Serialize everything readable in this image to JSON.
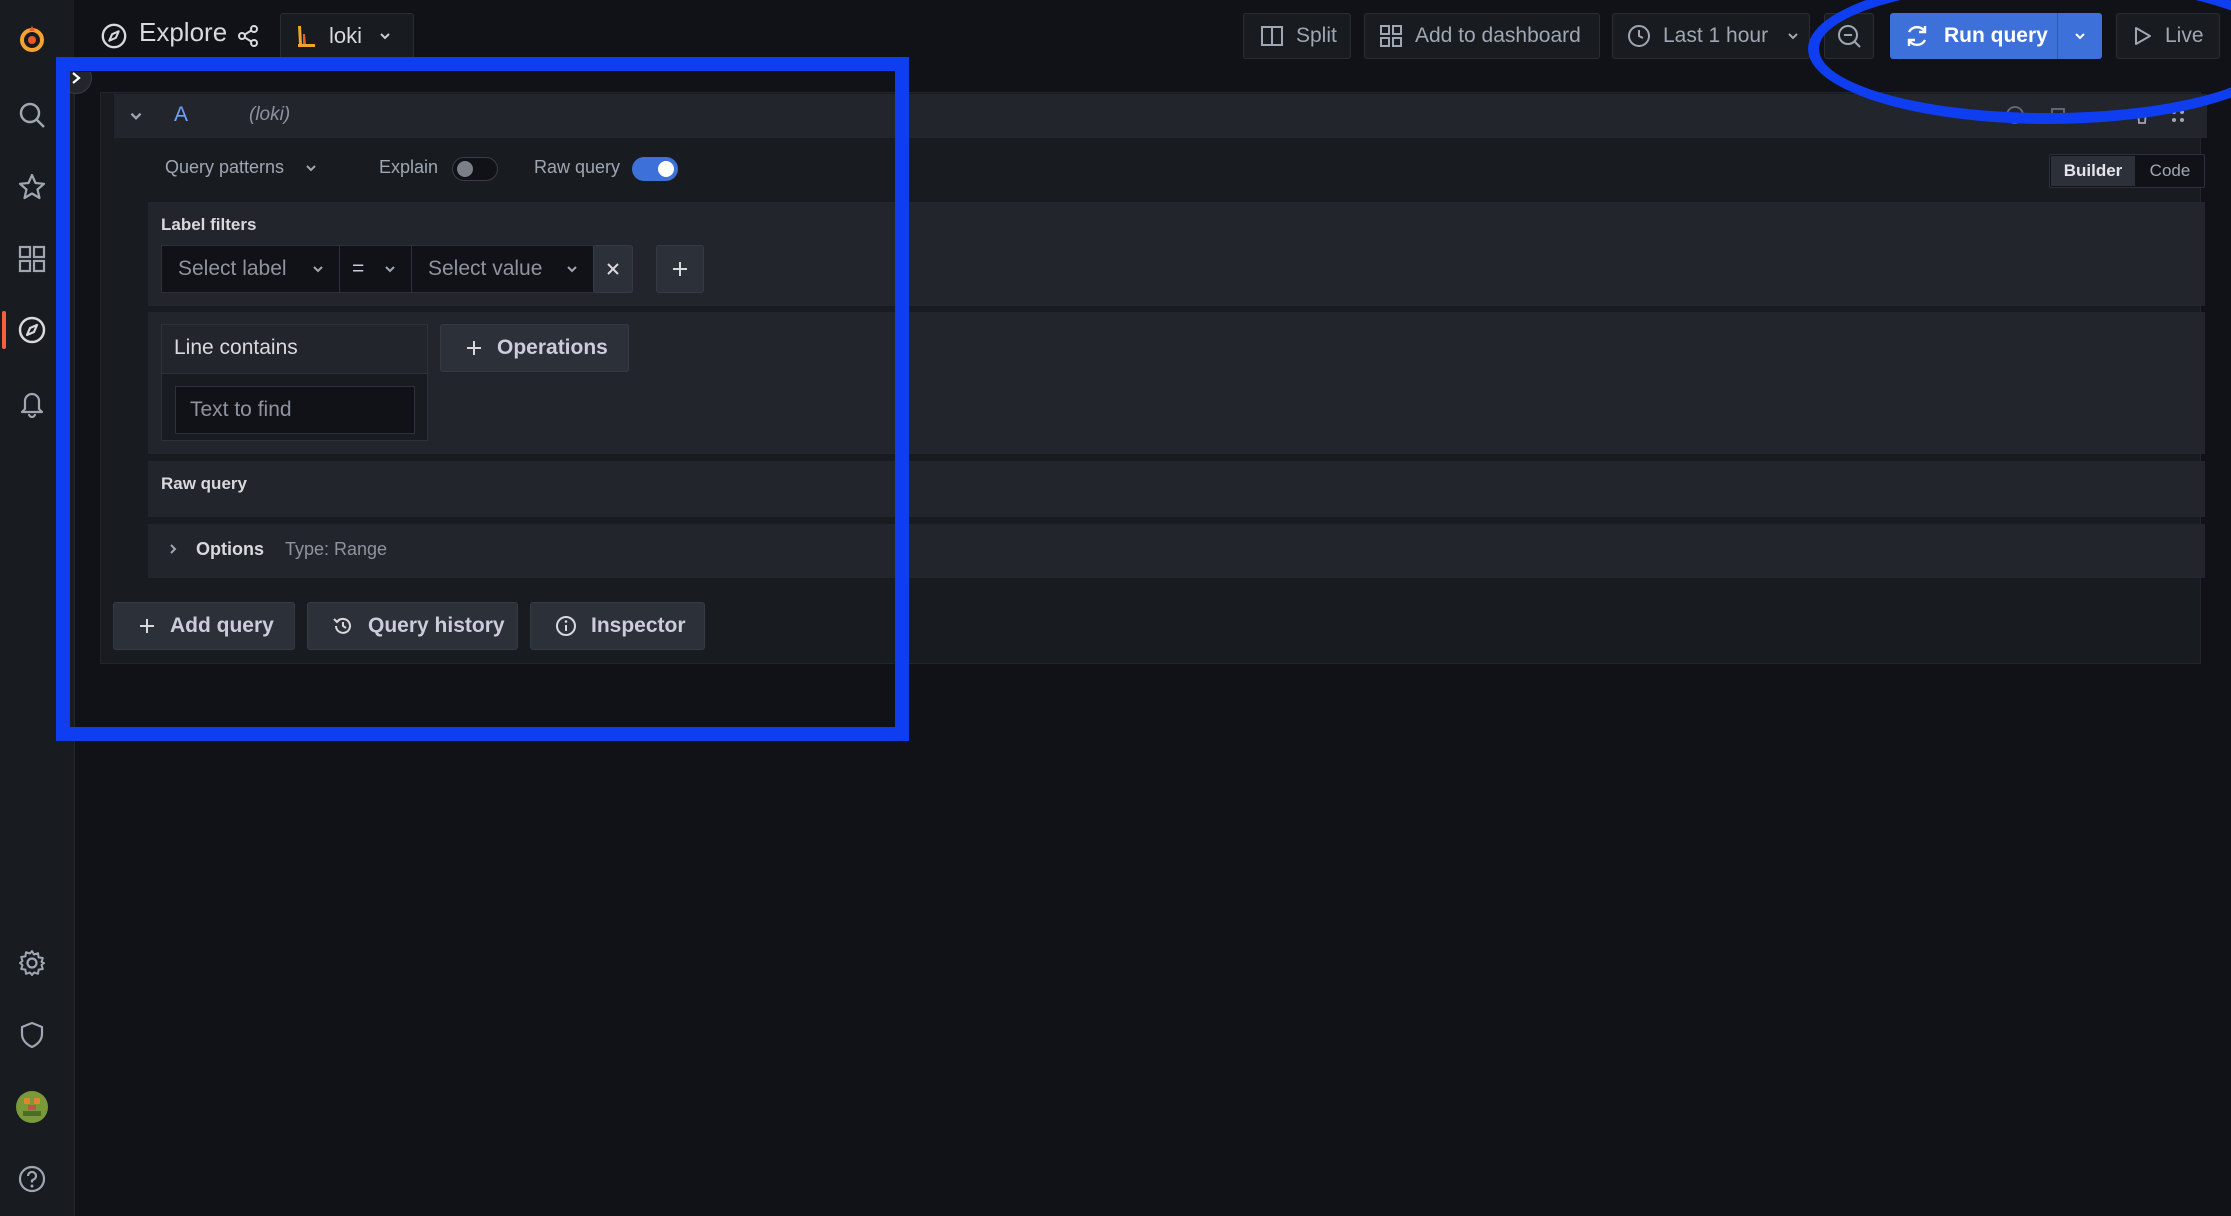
{
  "topbar": {
    "title": "Explore",
    "datasource": "loki",
    "split_label": "Split",
    "add_to_dashboard_label": "Add to dashboard",
    "time_range_label": "Last 1 hour",
    "run_query_label": "Run query",
    "live_label": "Live"
  },
  "query": {
    "ref_id": "A",
    "datasource_hint": "(loki)",
    "query_patterns_label": "Query patterns",
    "explain_label": "Explain",
    "raw_query_label": "Raw query",
    "builder_label": "Builder",
    "code_label": "Code",
    "label_filters_title": "Label filters",
    "select_label_placeholder": "Select label",
    "operator_value": "=",
    "select_value_placeholder": "Select value",
    "line_contains_label": "Line contains",
    "text_to_find_placeholder": "Text to find",
    "operations_label": "Operations",
    "raw_query_section_title": "Raw query",
    "options_label": "Options",
    "options_type": "Type: Range",
    "explain_on": false,
    "raw_query_on": true
  },
  "actions": {
    "add_query_label": "Add query",
    "query_history_label": "Query history",
    "inspector_label": "Inspector"
  },
  "colors": {
    "accent_blue": "#3d71d9",
    "run_query_blue": "#3d71d9",
    "annotation_blue": "#0f3df0",
    "grafana_orange": "#f55f3e",
    "background": "#111217",
    "panel": "#181b1f",
    "section": "#22252b"
  }
}
